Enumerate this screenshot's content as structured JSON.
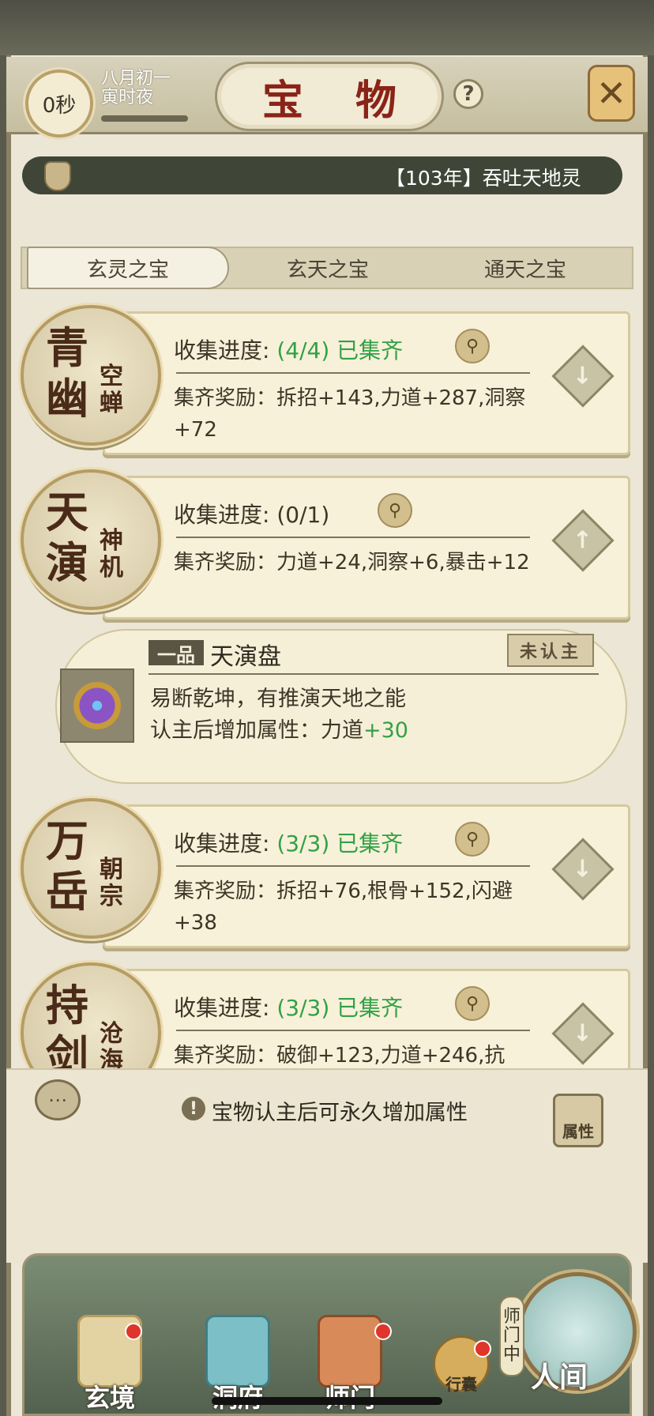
{
  "header": {
    "timer": "0秒",
    "date_line1": "八月初一",
    "date_line2": "寅时夜",
    "title": "宝 物",
    "help": "?",
    "close": "✕"
  },
  "notice": {
    "text": "【103年】吞吐天地灵"
  },
  "tabs": [
    {
      "label": "玄灵之宝",
      "active": true
    },
    {
      "label": "玄天之宝",
      "active": false
    },
    {
      "label": "通天之宝",
      "active": false
    }
  ],
  "treasures": [
    {
      "big1": "青",
      "big2": "幽",
      "small": "空蝉",
      "progress_label": "收集进度:",
      "progress_value": "(4/4)",
      "progress_status": "已集齐",
      "reward_label": "集齐奖励：",
      "reward_value": "拆招+143,力道+287,洞察+72",
      "expand": "↓"
    },
    {
      "big1": "天",
      "big2": "演",
      "small": "神机",
      "progress_label": "收集进度:",
      "progress_value": "(0/1)",
      "progress_status": "",
      "reward_label": "集齐奖励：",
      "reward_value": "力道+24,洞察+6,暴击+12",
      "expand": "↑"
    },
    {
      "big1": "万",
      "big2": "岳",
      "small": "朝宗",
      "progress_label": "收集进度:",
      "progress_value": "(3/3)",
      "progress_status": "已集齐",
      "reward_label": "集齐奖励：",
      "reward_value": "拆招+76,根骨+152,闪避+38",
      "expand": "↓"
    },
    {
      "big1": "持",
      "big2": "剑",
      "small": "沧海",
      "progress_label": "收集进度:",
      "progress_value": "(3/3)",
      "progress_status": "已集齐",
      "reward_label": "集齐奖励：",
      "reward_value": "破御+123,力道+246,抗",
      "expand": "↓"
    }
  ],
  "item": {
    "grade": "一品",
    "name": "天演盘",
    "status": "未认主",
    "desc": "易断乾坤，有推演天地之能",
    "attr_label": "认主后增加属性：力道",
    "attr_value": "+30"
  },
  "tip": "宝物认主后可永久增加属性",
  "attr_button": "属性",
  "nav": [
    {
      "label": "玄境",
      "badge": true
    },
    {
      "label": "洞府",
      "badge": false
    },
    {
      "label": "师门",
      "badge": true
    },
    {
      "label": "行囊",
      "badge": true
    },
    {
      "label": "人间",
      "badge": false
    }
  ],
  "master_tag": "师门中",
  "colors": {
    "accent_green": "#33a046",
    "title_red": "#8a2418",
    "badge_red": "#e0352a"
  }
}
